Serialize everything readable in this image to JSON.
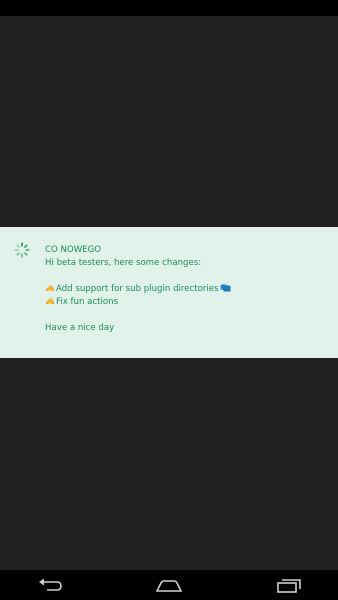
{
  "dialog": {
    "title": "CO NOWEGO",
    "intro": "Hi beta testers, here some changes:",
    "changes": [
      "Add support for sub plugin directories",
      "Fix fun actions"
    ],
    "outro": "Have a nice day",
    "text_color": "#1e8a5c",
    "background_color": "#e1f2ea"
  },
  "icons": {
    "progress": "loading-spinner-icon",
    "bullet": "fire-emoji-icon",
    "folder": "folder-emoji-icon"
  },
  "navigation": {
    "buttons": [
      "back",
      "home",
      "recent-apps"
    ]
  }
}
